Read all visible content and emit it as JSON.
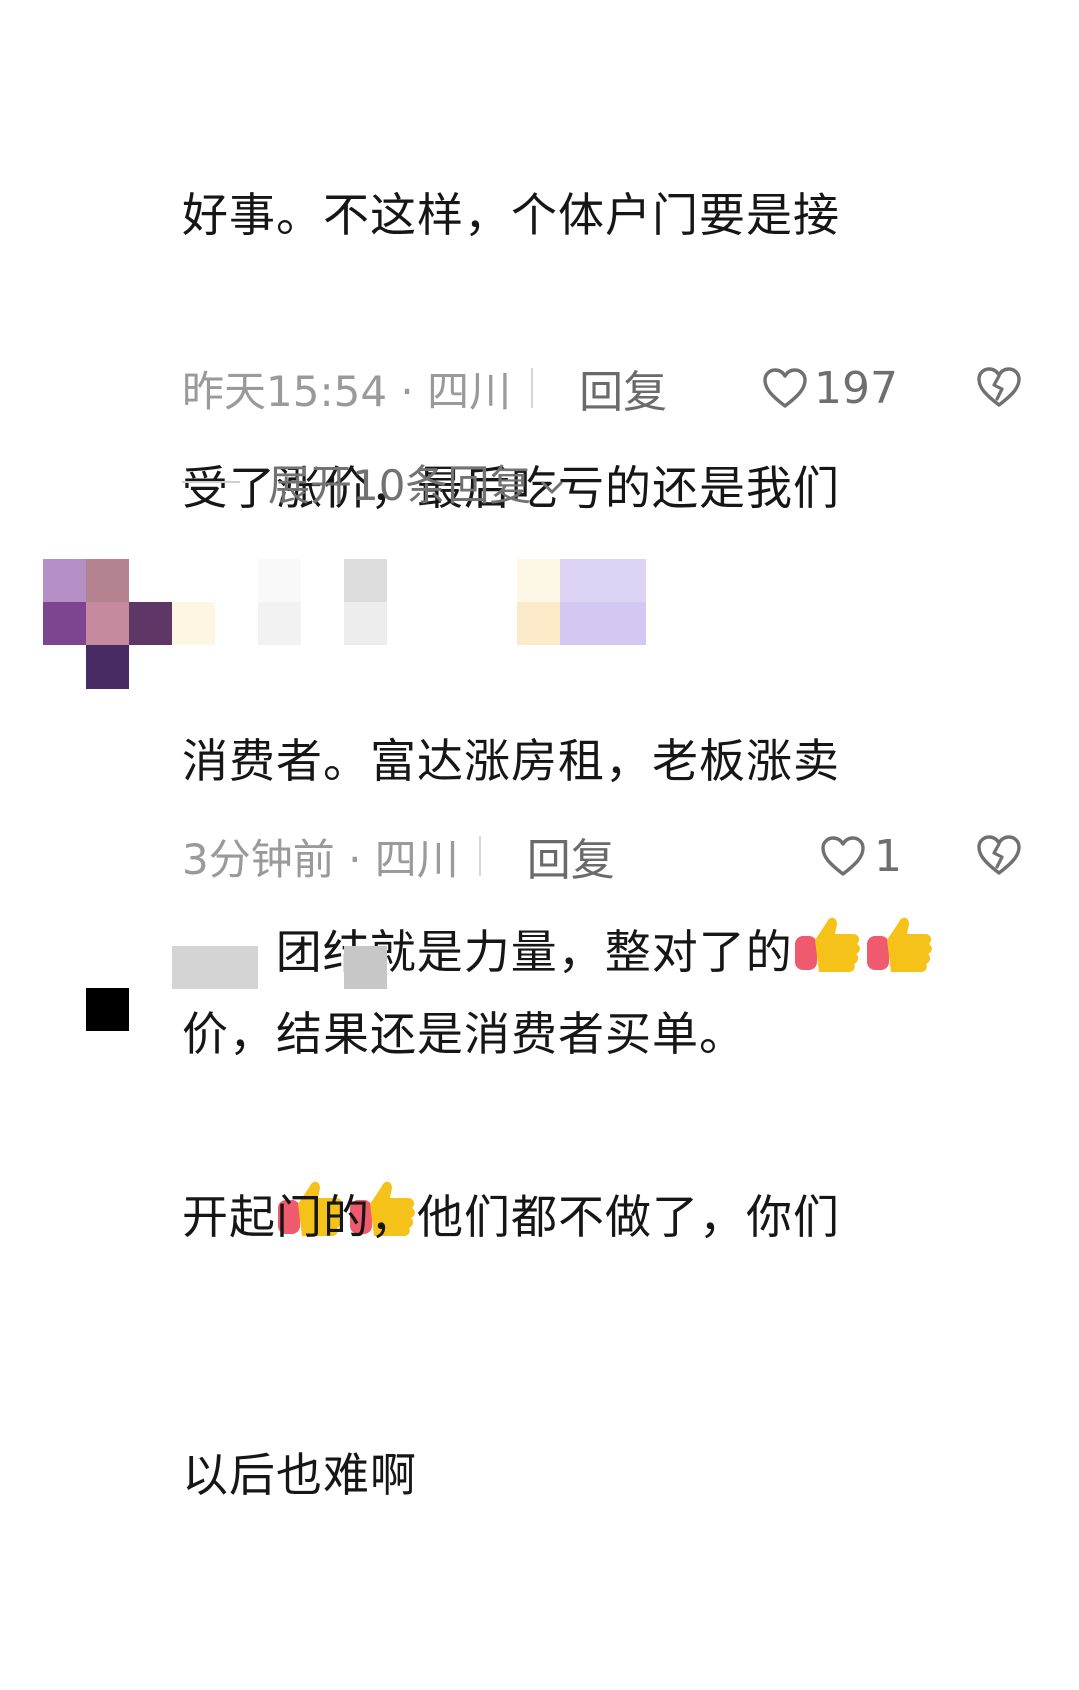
{
  "comments": [
    {
      "text_lines": [
        "好事。不这样，个体户门要是接",
        "受了涨价，最后吃亏的还是我们",
        "消费者。富达涨房租，老板涨卖",
        "价，结果还是消费者买单。"
      ],
      "time_location": "昨天15:54 · 四川",
      "reply_label": "回复",
      "like_count": "197",
      "expand_label": "展开10条回复"
    },
    {
      "text_line1": "团结就是力量，整对了的",
      "emoji": "thumbs-up-icon",
      "emoji_count": 4,
      "time_location": "3分钟前 · 四川",
      "reply_label": "回复",
      "like_count": "1"
    },
    {
      "text_lines": [
        "开起门的，他们都不做了，你们",
        "以后也难啊"
      ]
    }
  ],
  "colors": {
    "text": "#161616",
    "meta": "#9a9a9a",
    "action": "#6a6a6a",
    "emoji_yellow": "#f5c21a",
    "emoji_sleeve": "#ef5a6f"
  }
}
